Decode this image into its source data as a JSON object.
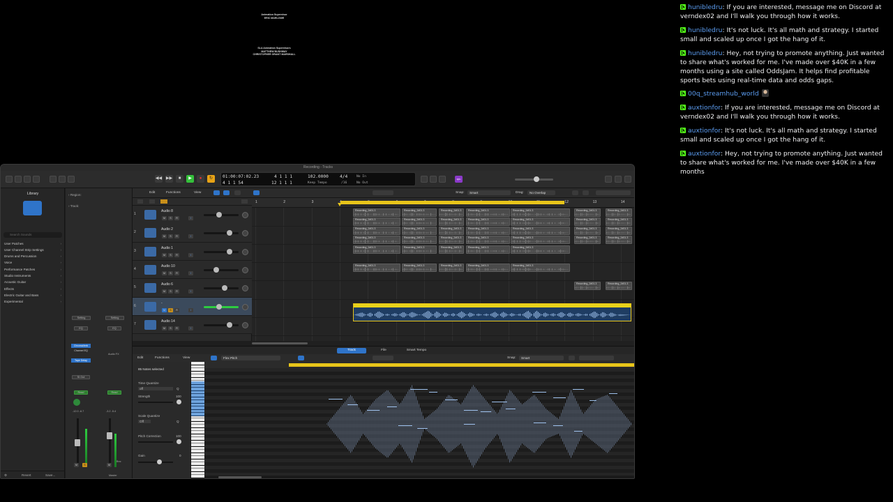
{
  "credits": {
    "block1": [
      "Animation Supervisor",
      "ERIC MARLOWE"
    ],
    "block2": [
      "SLA Animation Supervisors",
      "MATTHEW BUSHWAY",
      "CHRISTOPHER GRANT MARSHALL"
    ]
  },
  "chat": {
    "messages": [
      {
        "user": "hunibledru",
        "text": "If you are interested, message me on Discord at verndex02 and I'll walk you through how it works."
      },
      {
        "user": "hunibledru",
        "text": "It's not luck. It's all math and strategy. I started small and scaled up once I got the hang of it."
      },
      {
        "user": "hunibledru",
        "text": "Hey, not trying to promote anything. Just wanted to share what's worked for me. I've made over $40K in a few months using a site called OddsJam. It helps find profitable sports bets using real-time data and odds gaps."
      },
      {
        "user": "00q_streamhub_world",
        "text": ""
      },
      {
        "user": "auxtionfor",
        "text": "If you are interested, message me on Discord at verndex02 and I'll walk you through how it works."
      },
      {
        "user": "auxtionfor",
        "text": "It's not luck. It's all math and strategy. I started small and scaled up once I got the hang of it."
      },
      {
        "user": "auxtionfor",
        "text": "Hey, not trying to promote anything. Just wanted to share what's worked for me. I've made over $40K in a few months"
      }
    ]
  },
  "daw": {
    "window_title": "Recording - Tracks",
    "lcd": {
      "position": "01:00:07:02.23",
      "bars": "4 1 1 1",
      "bars2": "4 1 1 54",
      "bars3": "12 1 1 1",
      "tempo": "102.0000",
      "tempo_mode": "Keep Tempo",
      "signature": "4/4",
      "division": "/16",
      "in": "No In",
      "out": "No Out"
    },
    "smart_label": "cpu",
    "library": {
      "title": "Library",
      "search_placeholder": "Search Sounds",
      "items": [
        "User Patches",
        "User Channel Strip Settings",
        "Drums and Percussion",
        "Voice",
        "Performance Patches",
        "Studio Instruments",
        "Acoustic Guitar",
        "Effects",
        "Electric Guitar and Bass",
        "Experimental"
      ],
      "footer_left": "Revert",
      "footer_right": "Save..."
    },
    "inspector": {
      "region": "Region:",
      "track": "Track:",
      "setting": "Setting",
      "eq": "EQ",
      "plugins": [
        "ChromaVerb",
        "Channel EQ",
        "Tape Delay"
      ],
      "audio_fx": "Audio FX",
      "bnc": "Bnc",
      "stereo_out": "St Out",
      "read": "Read",
      "read2": "Read",
      "left_vals": [
        "-12.0",
        "-6.7"
      ],
      "right_vals": [
        "-3.2",
        "-5.4"
      ],
      "master": "Master",
      "m_label": "M",
      "s_label": "S"
    },
    "track_toolbar": {
      "edit": "Edit",
      "functions": "Functions",
      "view": "View",
      "snap_label": "Snap:",
      "snap_value": "Smart",
      "drag_label": "Drag:",
      "drag_value": "No Overlap"
    },
    "ruler": [
      "1",
      "2",
      "3",
      "4",
      "5",
      "6",
      "7",
      "8",
      "9",
      "10",
      "11",
      "12",
      "13",
      "14"
    ],
    "tracks": [
      {
        "num": "1",
        "name": "Audio 8"
      },
      {
        "num": "2",
        "name": "Audio 2"
      },
      {
        "num": "3",
        "name": "Audio 1"
      },
      {
        "num": "4",
        "name": "Audio 10"
      },
      {
        "num": "5",
        "name": "Audio 6"
      },
      {
        "num": "6",
        "name": "-"
      },
      {
        "num": "7",
        "name": "Audio 14"
      }
    ],
    "region_label": "Recording_2#01.3",
    "editor": {
      "tabs": [
        "Track",
        "File",
        "Smart Tempo"
      ],
      "edit": "Edit",
      "functions": "Functions",
      "view": "View",
      "flex_mode": "Flex Pitch",
      "snap_label": "Snap:",
      "snap_value": "Smart",
      "notes_selected": "85 Notes selected",
      "time_quantize": "Time Quantize",
      "time_quantize_value": "off",
      "strength": "Strength",
      "strength_value": "100",
      "scale_quantize": "Scale Quantize",
      "scale_value": "Off",
      "pitch_correction": "Pitch Correction",
      "pitch_value": "100",
      "gain": "Gain",
      "gain_value": "0",
      "q_label": "Q"
    }
  }
}
